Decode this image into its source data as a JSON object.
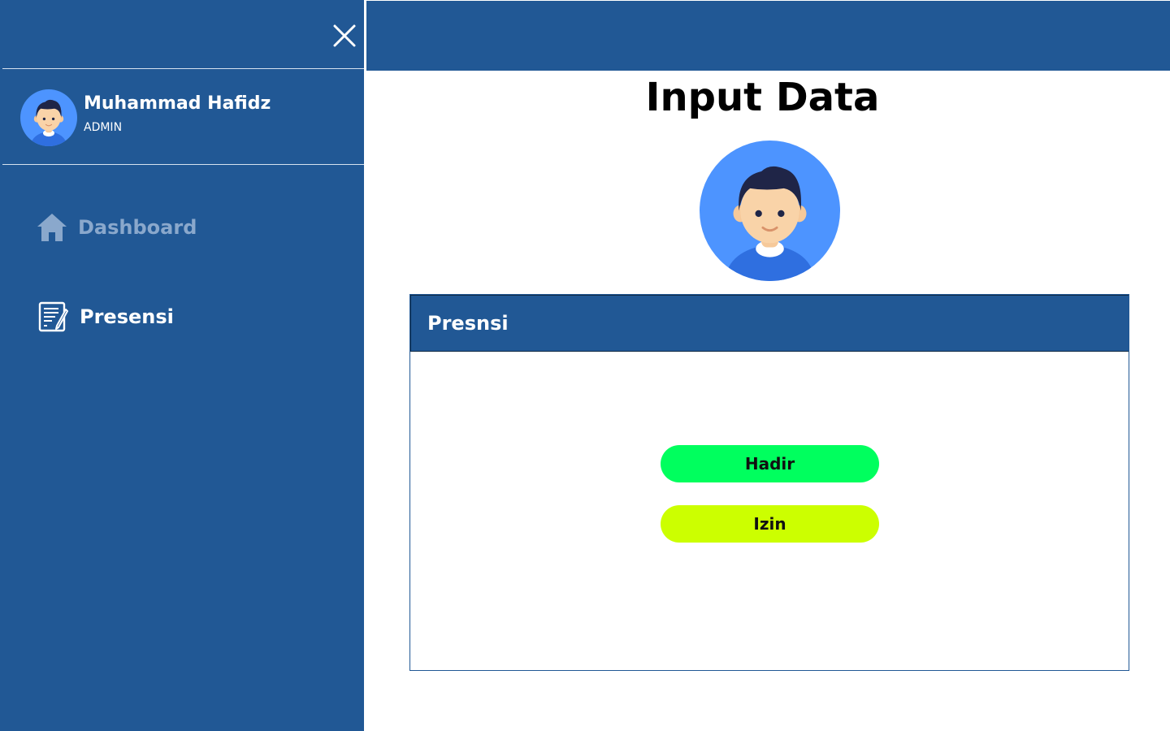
{
  "sidebar": {
    "user": {
      "name": "Muhammad Hafidz",
      "role": "ADMIN",
      "avatar_icon": "user-avatar-icon"
    },
    "close_icon": "close-icon",
    "nav": [
      {
        "label": "Dashboard",
        "icon": "home-icon",
        "state": "inactive"
      },
      {
        "label": "Presensi",
        "icon": "document-edit-icon",
        "state": "active"
      }
    ]
  },
  "main": {
    "title": "Input Data",
    "avatar_icon": "user-avatar-icon",
    "card": {
      "title": "Presnsi",
      "buttons": [
        {
          "label": "Hadir",
          "color": "#00ff5e"
        },
        {
          "label": "Izin",
          "color": "#ccff00"
        }
      ]
    }
  },
  "colors": {
    "primary": "#215895",
    "nav_inactive": "#8aa8cc",
    "hadir": "#00ff5e",
    "izin": "#ccff00"
  }
}
